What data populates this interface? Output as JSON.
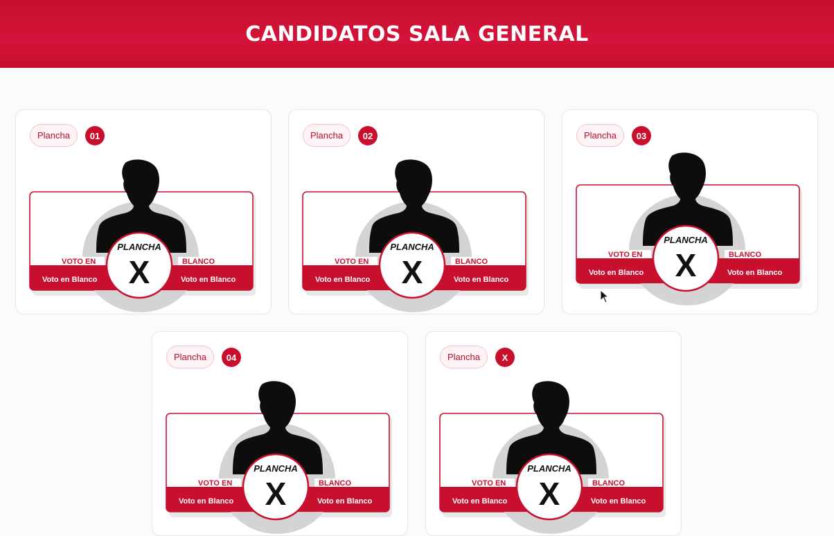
{
  "header": {
    "title": "CANDIDATOS SALA GENERAL"
  },
  "cards": [
    {
      "badge": "Plancha",
      "number": "01",
      "tile": {
        "voto_en": "VOTO EN",
        "blanco": "BLANCO",
        "plancha": "PLANCHA",
        "mark": "X",
        "bar_left": "Voto en Blanco",
        "bar_right": "Voto en Blanco"
      }
    },
    {
      "badge": "Plancha",
      "number": "02",
      "tile": {
        "voto_en": "VOTO EN",
        "blanco": "BLANCO",
        "plancha": "PLANCHA",
        "mark": "X",
        "bar_left": "Voto en Blanco",
        "bar_right": "Voto en Blanco"
      }
    },
    {
      "badge": "Plancha",
      "number": "03",
      "tile": {
        "voto_en": "VOTO EN",
        "blanco": "BLANCO",
        "plancha": "PLANCHA",
        "mark": "X",
        "bar_left": "Voto en Blanco",
        "bar_right": "Voto en Blanco"
      }
    },
    {
      "badge": "Plancha",
      "number": "04",
      "tile": {
        "voto_en": "VOTO EN",
        "blanco": "BLANCO",
        "plancha": "PLANCHA",
        "mark": "X",
        "bar_left": "Voto en Blanco",
        "bar_right": "Voto en Blanco"
      }
    },
    {
      "badge": "Plancha",
      "number": "X",
      "tile": {
        "voto_en": "VOTO EN",
        "blanco": "BLANCO",
        "plancha": "PLANCHA",
        "mark": "X",
        "bar_left": "Voto en Blanco",
        "bar_right": "Voto en Blanco"
      }
    }
  ],
  "icons": {
    "cursor": "mouse-pointer-icon"
  },
  "colors": {
    "brand_red": "#c8102e",
    "silhouette": "#0d0d0d",
    "shadow": "#cfcfcf"
  }
}
